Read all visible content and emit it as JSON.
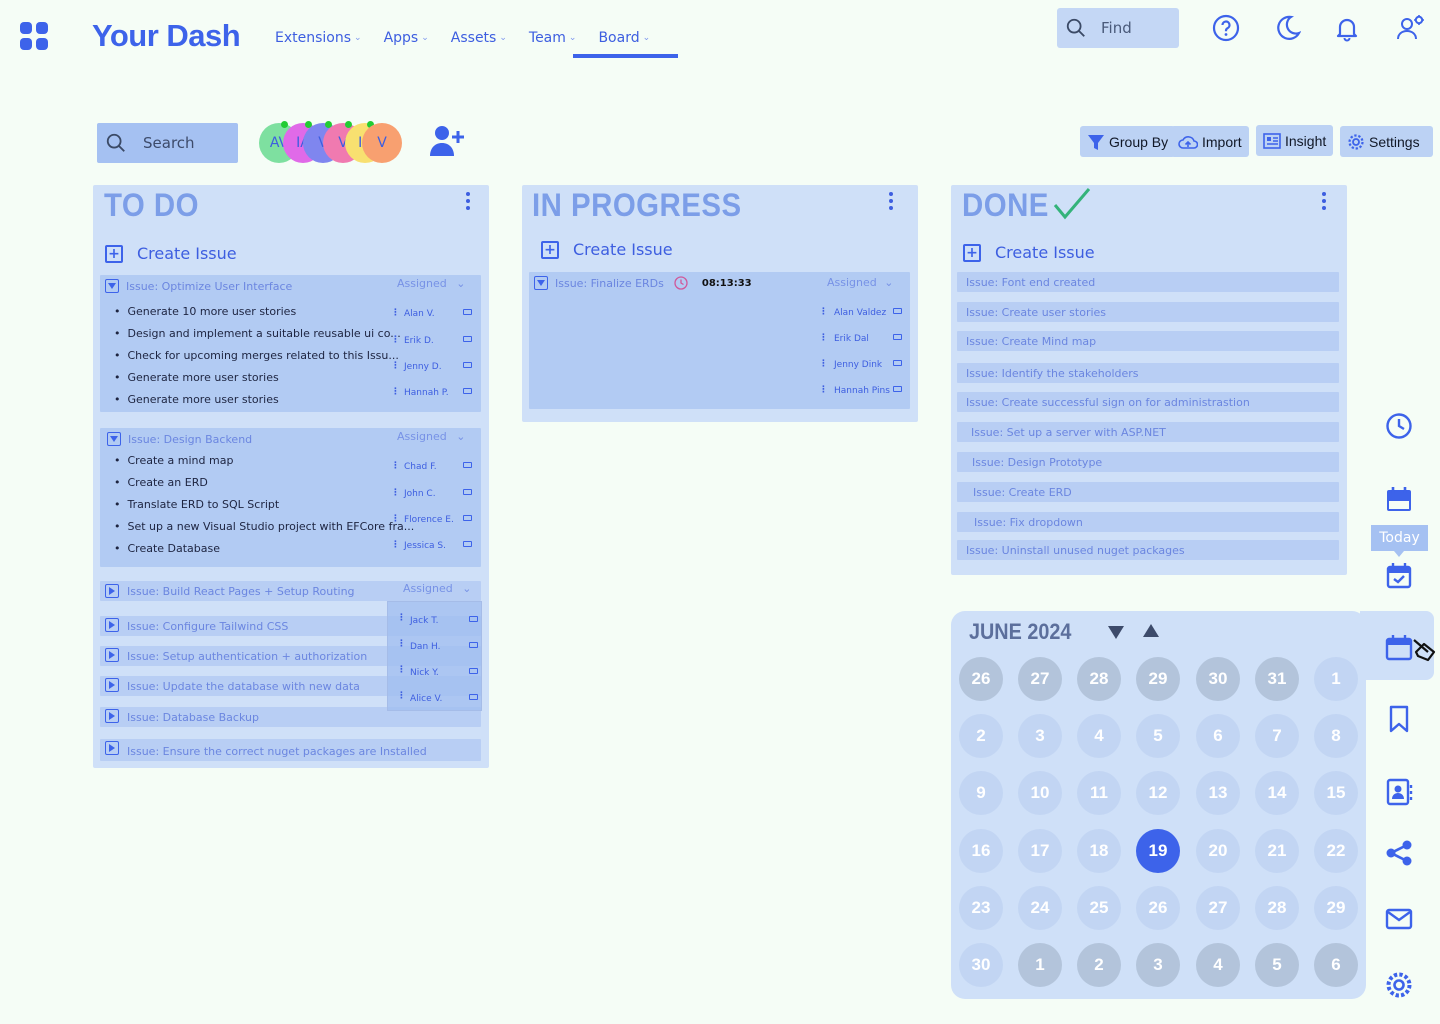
{
  "app": {
    "title": "Your Dash"
  },
  "nav": {
    "items": [
      "Extensions",
      "Apps",
      "Assets",
      "Team",
      "Board"
    ],
    "active": "Board"
  },
  "find": {
    "placeholder": "Find"
  },
  "toolbar": {
    "search_placeholder": "Search",
    "avatars": [
      "AV",
      "IA",
      "V",
      "V",
      "IA",
      "V"
    ],
    "buttons": {
      "group_by": "Group By",
      "import": "Import",
      "insight": "Insight",
      "settings": "Settings"
    }
  },
  "columns": {
    "todo": {
      "title": "TO DO",
      "create_label": "Create Issue",
      "cards": [
        {
          "title": "Issue: Optimize User Interface",
          "assigned_label": "Assigned",
          "tasks": [
            "Generate 10 more user stories",
            "Design and implement a suitable reusable  ui co...",
            "Check for upcoming merges related to this  Issu...",
            "Generate more user stories",
            "Generate more user stories"
          ],
          "people": [
            "Alan V.",
            "Erik D.",
            "Jenny D.",
            "Hannah P."
          ]
        },
        {
          "title": "Issue: Design Backend",
          "assigned_label": "Assigned",
          "tasks": [
            "Create a mind map",
            "Create an ERD",
            "Translate ERD to SQL Script",
            "Set up a new Visual Studio project with EFCore fra...",
            "Create Database"
          ],
          "people": [
            "Chad F.",
            "John C.",
            "Florence E.",
            "Jessica S."
          ]
        }
      ],
      "collapsed": [
        {
          "title": "Issue: Build React Pages + Setup Routing",
          "assigned_label": "Assigned"
        },
        {
          "title": "Issue: Configure Tailwind CSS"
        },
        {
          "title": "Issue:  Setup authentication + authorization"
        },
        {
          "title": "Issue:  Update the database with new data"
        },
        {
          "title": "Issue: Database Backup"
        },
        {
          "title": "Issue:  Ensure the correct  nuget packages are Installed"
        }
      ],
      "dropdown_people": [
        "Jack T.",
        "Dan H.",
        "Nick Y.",
        "Alice V."
      ]
    },
    "in_progress": {
      "title": "IN PROGRESS",
      "create_label": "Create Issue",
      "card": {
        "title": "Issue: Finalize ERDs",
        "timer": "08:13:33",
        "assigned_label": "Assigned",
        "people": [
          "Alan Valdez",
          "Erik Dal",
          "Jenny Dink",
          "Hannah Pins"
        ]
      }
    },
    "done": {
      "title": "DONE",
      "create_label": "Create Issue",
      "items": [
        "Issue:  Font end created",
        "Issue:  Create user stories",
        "Issue:  Create Mind map",
        "Issue:  Identify the stakeholders",
        "Issue:  Create successful sign on for administrastion",
        "Issue:  Set up  a server with ASP.NET",
        "Issue: Design Prototype",
        "Issue:  Create ERD",
        "Issue:  Fix dropdown",
        "Issue:  Uninstall unused nuget packages"
      ]
    }
  },
  "calendar": {
    "month_label": "JUNE 2024",
    "selected": "19",
    "weeks": [
      [
        "26",
        "27",
        "28",
        "29",
        "30",
        "31",
        "1"
      ],
      [
        "2",
        "3",
        "4",
        "5",
        "6",
        "7",
        "8"
      ],
      [
        "9",
        "10",
        "11",
        "12",
        "13",
        "14",
        "15"
      ],
      [
        "16",
        "17",
        "18",
        "19",
        "20",
        "21",
        "22"
      ],
      [
        "23",
        "24",
        "25",
        "26",
        "27",
        "28",
        "29"
      ],
      [
        "30",
        "1",
        "2",
        "3",
        "4",
        "5",
        "6"
      ]
    ]
  },
  "sidebar": {
    "today_tooltip": "Today"
  },
  "colors": {
    "accent": "#3d63ea",
    "column_bg": "#cfe0f8",
    "card_bg": "#b2cbf3",
    "page_bg": "#f5fdf6",
    "done_check": "#34b37a"
  }
}
